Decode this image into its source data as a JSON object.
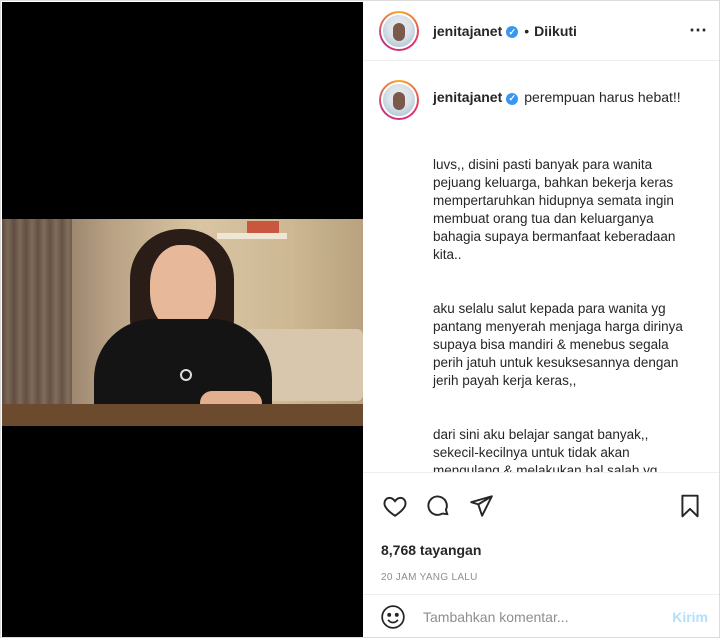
{
  "post": {
    "username": "jenitajanet",
    "follow_dot": "•",
    "follow_status": "Diikuti",
    "more_icon": "⋯"
  },
  "caption": {
    "first_line": "perempuan harus hebat!!",
    "paragraphs": [
      "luvs,, disini pasti banyak para wanita\npejuang keluarga, bahkan bekerja keras\nmempertaruhkan hidupnya semata ingin\nmembuat orang tua dan keluarganya\nbahagia supaya bermanfaat keberadaan\nkita..",
      "aku selalu salut kepada para wanita yg\npantang menyerah menjaga harga dirinya\nsupaya bisa mandiri & menebus segala\nperih jatuh untuk kesuksesannya dengan\njerih payah kerja keras,,",
      "dari sini aku belajar sangat banyak,,\nsekecil-kecilnya untuk tidak akan\nmengulang & melakukan hal salah yg\nsama sedikitpun,,"
    ]
  },
  "actions": {
    "icons": [
      "heart-icon",
      "comment-icon",
      "share-icon",
      "bookmark-icon"
    ],
    "views": "8,768 tayangan",
    "time": "20 JAM YANG LALU"
  },
  "comment_box": {
    "placeholder": "Tambahkan komentar...",
    "post_label": "Kirim",
    "emoji_icon": "smiley-icon"
  },
  "colors": {
    "verified": "#3897f0",
    "post_button_disabled": "#b2dffc",
    "secondary_text": "#8e8e8e"
  }
}
